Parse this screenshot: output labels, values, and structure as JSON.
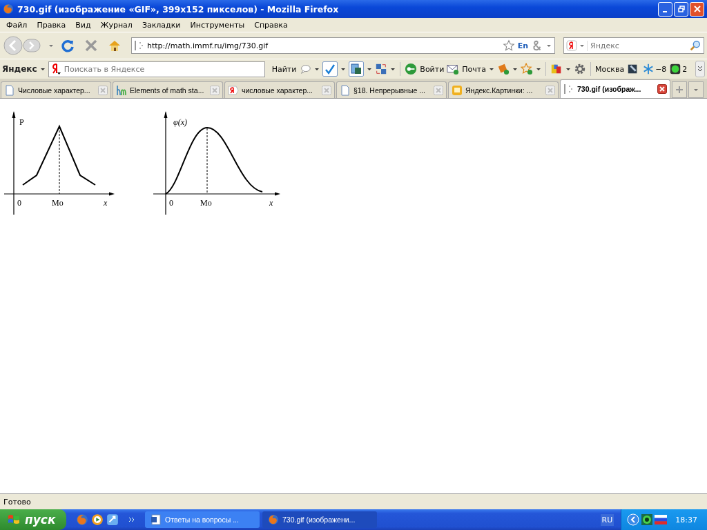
{
  "window": {
    "title": "730.gif (изображение «GIF», 399x152 пикселов) - Mozilla Firefox"
  },
  "menu": [
    "Файл",
    "Правка",
    "Вид",
    "Журнал",
    "Закладки",
    "Инструменты",
    "Справка"
  ],
  "address": {
    "value": "http://math.immf.ru/img/730.gif",
    "lang": "En"
  },
  "search": {
    "placeholder": "Яндекс"
  },
  "yandex_bar": {
    "logo": "Яндекс",
    "placeholder": "Поискать в Яндексе",
    "find": "Найти",
    "login": "Войти",
    "mail": "Почта",
    "city": "Москва",
    "temperature": "−8",
    "count": "2"
  },
  "tabs": [
    {
      "label": "Числовые характер...",
      "kind": "page",
      "selected": false
    },
    {
      "label": "Elements of math sta...",
      "kind": "hm",
      "selected": false
    },
    {
      "label": "числовые характер...",
      "kind": "yandex",
      "selected": false
    },
    {
      "label": "§18. Непрерывные ...",
      "kind": "page",
      "selected": false
    },
    {
      "label": "Яндекс.Картинки: ...",
      "kind": "images",
      "selected": false
    },
    {
      "label": "730.gif (изображ...",
      "kind": "loading",
      "selected": true
    }
  ],
  "figures": [
    {
      "kind": "polyline",
      "y_label": "P",
      "origin": "0",
      "mode_label": "Mo",
      "x_label": "x"
    },
    {
      "kind": "smooth",
      "y_label": "φ(x)",
      "origin": "0",
      "mode_label": "Mo",
      "x_label": "x"
    }
  ],
  "status_bar": "Готово",
  "taskbar": {
    "start": "пуск",
    "tasks": [
      {
        "label": "Ответы на вопросы ...",
        "kind": "word",
        "selected": false
      },
      {
        "label": "730.gif (изображени...",
        "kind": "firefox",
        "selected": true
      }
    ],
    "language": "RU",
    "clock": "18:37"
  }
}
